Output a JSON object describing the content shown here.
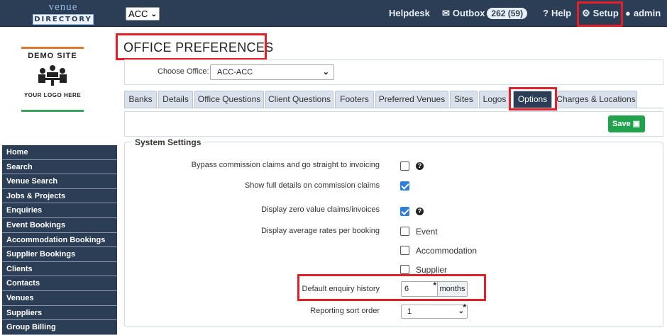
{
  "brand": {
    "line1": "venue",
    "line2": "DIRECTORY"
  },
  "topnav": {
    "office_select": "ACC",
    "helpdesk": "Helpdesk",
    "outbox_label": "Outbox",
    "outbox_badge": "262 (59)",
    "help": "Help",
    "setup": "Setup",
    "user": "admin"
  },
  "site_logo": {
    "title": "DEMO SITE",
    "subtitle": "YOUR LOGO HERE"
  },
  "sidebar": {
    "items": [
      {
        "label": "Home"
      },
      {
        "label": "Search"
      },
      {
        "label": "Venue Search"
      },
      {
        "label": "Jobs & Projects"
      },
      {
        "label": "Enquiries"
      },
      {
        "label": "Event Bookings"
      },
      {
        "label": "Accommodation Bookings"
      },
      {
        "label": "Supplier Bookings"
      },
      {
        "label": "Clients"
      },
      {
        "label": "Contacts"
      },
      {
        "label": "Venues"
      },
      {
        "label": "Suppliers"
      },
      {
        "label": "Group Billing"
      }
    ]
  },
  "page": {
    "title": "OFFICE PREFERENCES",
    "choose_office_label": "Choose Office:",
    "choose_office_value": "ACC-ACC"
  },
  "tabs": [
    {
      "label": "Banks"
    },
    {
      "label": "Details"
    },
    {
      "label": "Office Questions"
    },
    {
      "label": "Client Questions"
    },
    {
      "label": "Footers"
    },
    {
      "label": "Preferred Venues"
    },
    {
      "label": "Sites"
    },
    {
      "label": "Logos"
    },
    {
      "label": "Options",
      "active": true
    },
    {
      "label": "Charges & Locations"
    }
  ],
  "toolbar": {
    "save_label": "Save"
  },
  "system_settings": {
    "legend": "System Settings",
    "bypass_label": "Bypass commission claims and go straight to invoicing",
    "bypass_checked": false,
    "full_details_label": "Show full details on commission claims",
    "full_details_checked": true,
    "zero_value_label": "Display zero value claims/invoices",
    "zero_value_checked": true,
    "avg_rates_label": "Display average rates per booking",
    "avg_rates_options": [
      {
        "label": "Event",
        "checked": false
      },
      {
        "label": "Accommodation",
        "checked": false
      },
      {
        "label": "Supplier",
        "checked": false
      }
    ],
    "enquiry_history_label": "Default enquiry history",
    "enquiry_history_value": "6",
    "enquiry_history_unit": "months",
    "sort_order_label": "Reporting sort order",
    "sort_order_value": "1",
    "required_mark": "*"
  },
  "colors": {
    "nav": "#2c3e55",
    "save": "#21a34d",
    "highlight": "#e3202a",
    "checkbox": "#2f7fd8"
  }
}
